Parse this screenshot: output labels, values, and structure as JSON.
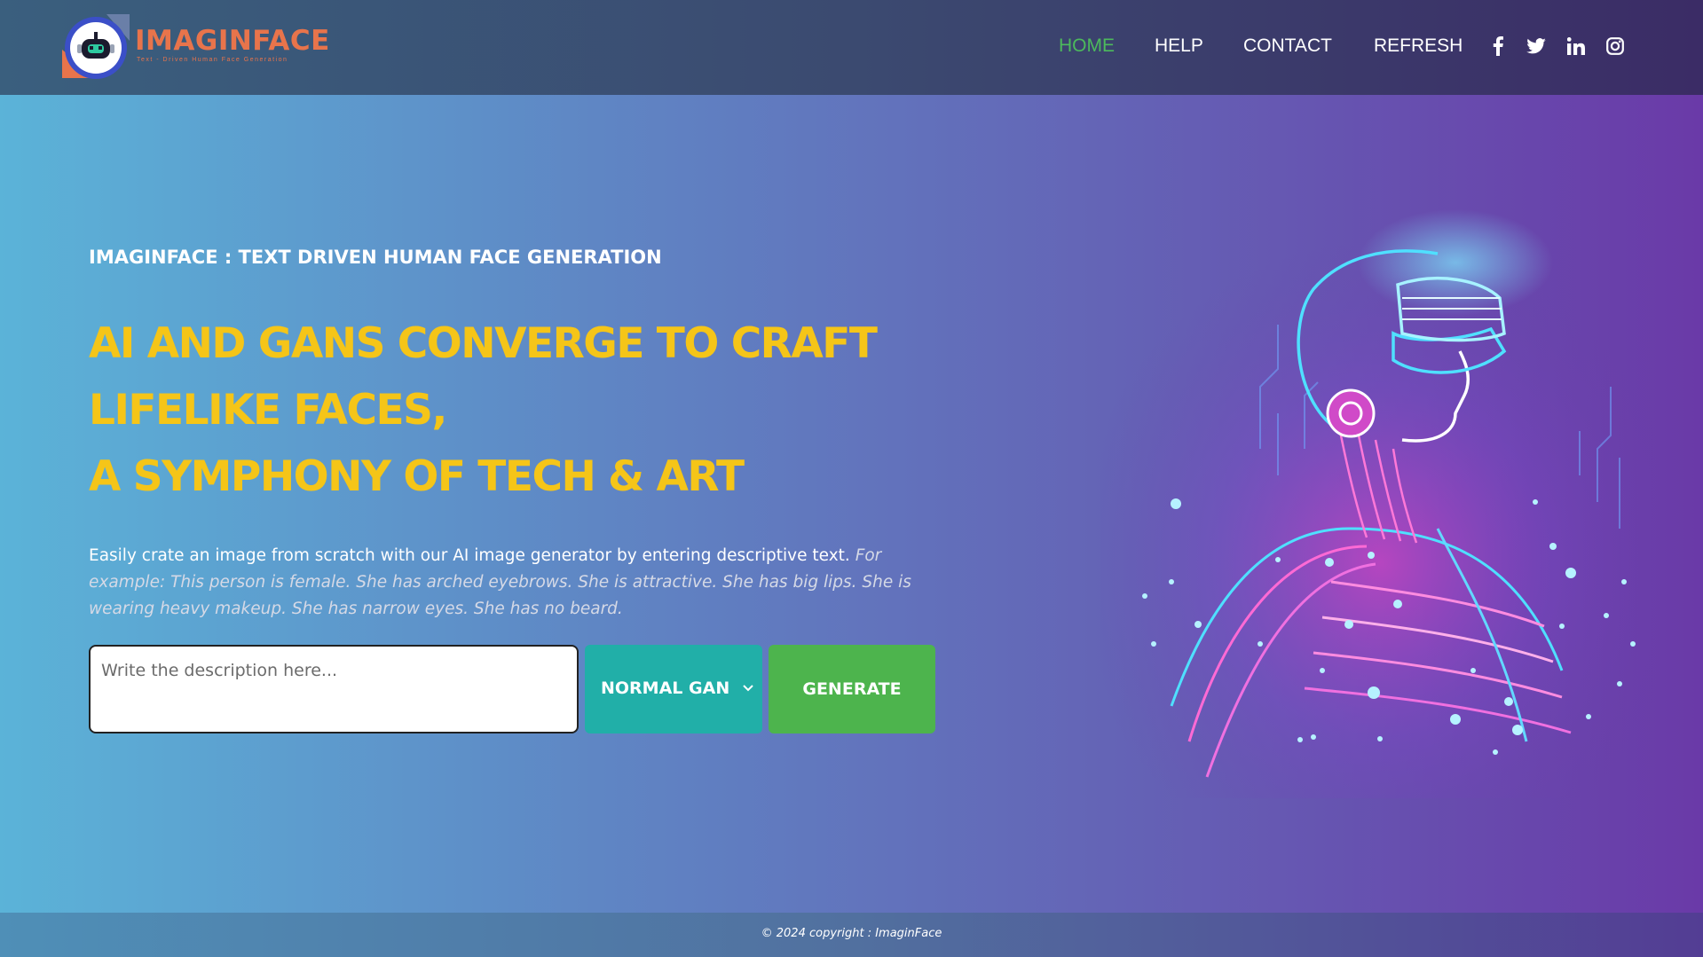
{
  "brand": {
    "name": "IMAGINFACE",
    "tagline": "Text - Driven Human Face Generation"
  },
  "nav": {
    "items": [
      {
        "label": "HOME",
        "active": true
      },
      {
        "label": "HELP",
        "active": false
      },
      {
        "label": "CONTACT",
        "active": false
      },
      {
        "label": "REFRESH",
        "active": false
      }
    ],
    "social": [
      "facebook-icon",
      "twitter-icon",
      "linkedin-icon",
      "instagram-icon"
    ]
  },
  "hero": {
    "kicker": "IMAGINFACE : TEXT DRIVEN HUMAN FACE GENERATION",
    "headline_lines": [
      "AI AND GANS CONVERGE TO CRAFT",
      "LIFELIKE FACES,",
      "A SYMPHONY OF TECH & ART"
    ],
    "description": "Easily crate an image from scratch with our AI image generator by entering descriptive text.",
    "example": "For example: This person is female. She has arched eyebrows. She is attractive. She has big lips. She is wearing heavy makeup. She has narrow eyes. She has no beard."
  },
  "form": {
    "placeholder": "Write the description here...",
    "model_selected": "NORMAL GAN",
    "generate_label": "GENERATE"
  },
  "footer": {
    "copyright": "© 2024 copyright : ImaginFace"
  },
  "colors": {
    "accent_yellow": "#f5c518",
    "nav_active": "#4cba5c",
    "select_teal": "#21afa8",
    "button_green": "#4db44d",
    "brand_orange": "#e8744b"
  }
}
